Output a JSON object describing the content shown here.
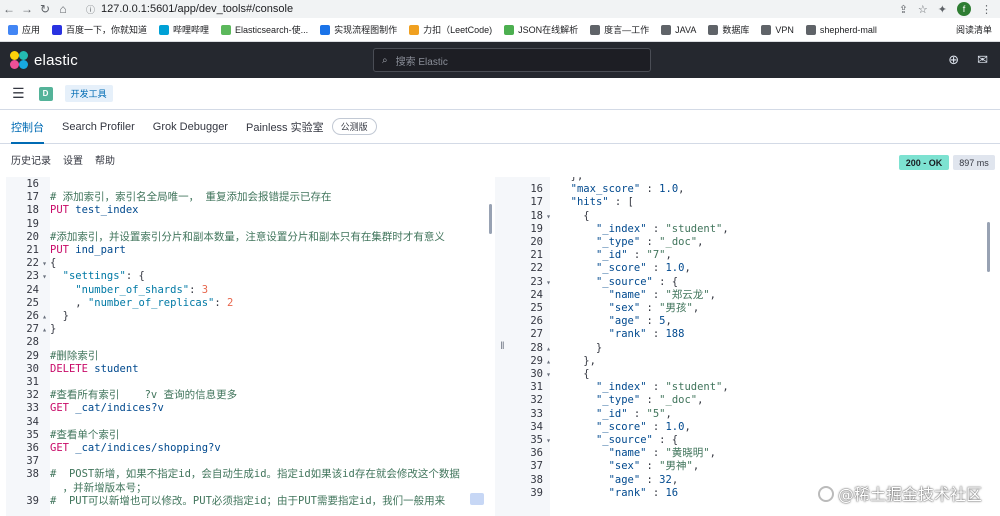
{
  "browser": {
    "url": "127.0.0.1:5601/app/dev_tools#/console",
    "profile_initial": "f"
  },
  "bookmarks": [
    {
      "label": "应用",
      "color": "#4285f4"
    },
    {
      "label": "百度一下，你就知道",
      "color": "#2932e1"
    },
    {
      "label": "哔哩哔哩",
      "color": "#00a1d6"
    },
    {
      "label": "Elasticsearch-使...",
      "color": "#5cb85c"
    },
    {
      "label": "实现流程图制作",
      "color": "#1a73e8"
    },
    {
      "label": "力扣（LeetCode)",
      "color": "#f0a020"
    },
    {
      "label": "JSON在线解析",
      "color": "#4caf50"
    },
    {
      "label": "度言—工作",
      "color": "#5f6368"
    },
    {
      "label": "JAVA",
      "color": "#5f6368"
    },
    {
      "label": "数据库",
      "color": "#5f6368"
    },
    {
      "label": "VPN",
      "color": "#5f6368"
    },
    {
      "label": "shepherd-mall",
      "color": "#5f6368"
    }
  ],
  "bookmarks_right": "阅读清单",
  "header": {
    "logo_text": "elastic",
    "search_placeholder": "搜索 Elastic"
  },
  "breadcrumb": {
    "space": "D",
    "current": "开发工具"
  },
  "tabs": [
    {
      "label": "控制台",
      "active": true
    },
    {
      "label": "Search Profiler",
      "active": false
    },
    {
      "label": "Grok Debugger",
      "active": false
    },
    {
      "label": "Painless 实验室",
      "active": false
    }
  ],
  "beta_label": "公测版",
  "toolbar": {
    "history": "历史记录",
    "settings": "设置",
    "help": "帮助",
    "status": "200 - OK",
    "time": "897 ms"
  },
  "request_lines": [
    {
      "n": "16",
      "f": "",
      "t": [
        [
          "",
          ""
        ]
      ]
    },
    {
      "n": "17",
      "f": "",
      "t": [
        [
          "comment",
          "# 添加索引，索引名全局唯一， 重复添加会报错提示已存在"
        ]
      ]
    },
    {
      "n": "18",
      "f": "",
      "t": [
        [
          "method",
          "PUT"
        ],
        [
          "path",
          " test_index"
        ]
      ]
    },
    {
      "n": "19",
      "f": "",
      "t": [
        [
          "",
          ""
        ]
      ]
    },
    {
      "n": "20",
      "f": "",
      "t": [
        [
          "comment",
          "#添加索引，并设置索引分片和副本数量，注意设置分片和副本只有在集群时才有意义"
        ]
      ]
    },
    {
      "n": "21",
      "f": "",
      "t": [
        [
          "method",
          "PUT"
        ],
        [
          "path",
          " ind_part"
        ]
      ]
    },
    {
      "n": "22",
      "f": "▾",
      "t": [
        [
          "punc",
          "{"
        ]
      ]
    },
    {
      "n": "23",
      "f": "▾",
      "t": [
        [
          "punc",
          "  "
        ],
        [
          "key",
          "\"settings\""
        ],
        [
          "punc",
          ": {"
        ]
      ]
    },
    {
      "n": "24",
      "f": "",
      "t": [
        [
          "punc",
          "    "
        ],
        [
          "key",
          "\"number_of_shards\""
        ],
        [
          "punc",
          ": "
        ],
        [
          "num",
          "3"
        ]
      ]
    },
    {
      "n": "25",
      "f": "",
      "t": [
        [
          "punc",
          "    , "
        ],
        [
          "key",
          "\"number_of_replicas\""
        ],
        [
          "punc",
          ": "
        ],
        [
          "num",
          "2"
        ]
      ]
    },
    {
      "n": "26",
      "f": "▴",
      "t": [
        [
          "punc",
          "  }"
        ]
      ]
    },
    {
      "n": "27",
      "f": "▴",
      "t": [
        [
          "punc",
          "}"
        ]
      ]
    },
    {
      "n": "28",
      "f": "",
      "t": [
        [
          "",
          ""
        ]
      ]
    },
    {
      "n": "29",
      "f": "",
      "t": [
        [
          "comment",
          "#删除索引"
        ]
      ]
    },
    {
      "n": "30",
      "f": "",
      "t": [
        [
          "method",
          "DELETE"
        ],
        [
          "path",
          " student"
        ]
      ]
    },
    {
      "n": "31",
      "f": "",
      "t": [
        [
          "",
          ""
        ]
      ]
    },
    {
      "n": "32",
      "f": "",
      "t": [
        [
          "comment",
          "#查看所有索引    ?v 查询的信息更多"
        ]
      ]
    },
    {
      "n": "33",
      "f": "",
      "t": [
        [
          "method",
          "GET"
        ],
        [
          "path",
          " _cat/indices?v"
        ]
      ]
    },
    {
      "n": "34",
      "f": "",
      "t": [
        [
          "",
          ""
        ]
      ]
    },
    {
      "n": "35",
      "f": "",
      "t": [
        [
          "comment",
          "#查看单个索引"
        ]
      ]
    },
    {
      "n": "36",
      "f": "",
      "t": [
        [
          "method",
          "GET"
        ],
        [
          "path",
          " _cat/indices/shopping?v"
        ]
      ]
    },
    {
      "n": "37",
      "f": "",
      "t": [
        [
          "",
          ""
        ]
      ]
    },
    {
      "n": "38",
      "f": "",
      "t": [
        [
          "comment",
          "#  POST新增，如果不指定id，会自动生成id。指定id如果该id存在就会修改这个数据"
        ]
      ]
    },
    {
      "n": "",
      "f": "",
      "t": [
        [
          "comment",
          "  ，并新增版本号；"
        ]
      ]
    },
    {
      "n": "39",
      "f": "",
      "t": [
        [
          "comment",
          "#  PUT可以新增也可以修改。PUT必须指定id；由于PUT需要指定id，我们一般用来"
        ]
      ]
    }
  ],
  "response_lines": [
    {
      "n": "",
      "f": "",
      "t": [
        [
          "punc",
          "  },"
        ]
      ]
    },
    {
      "n": "16",
      "f": "",
      "t": [
        [
          "punc",
          "  "
        ],
        [
          "rkey",
          "\"max_score\""
        ],
        [
          "punc",
          " : "
        ],
        [
          "rnum",
          "1.0"
        ],
        [
          "punc",
          ","
        ]
      ]
    },
    {
      "n": "17",
      "f": "",
      "t": [
        [
          "punc",
          "  "
        ],
        [
          "rkey",
          "\"hits\""
        ],
        [
          "punc",
          " : ["
        ]
      ]
    },
    {
      "n": "18",
      "f": "▾",
      "t": [
        [
          "punc",
          "    {"
        ]
      ]
    },
    {
      "n": "19",
      "f": "",
      "t": [
        [
          "punc",
          "      "
        ],
        [
          "rkey",
          "\"_index\""
        ],
        [
          "punc",
          " : "
        ],
        [
          "rstr",
          "\"student\""
        ],
        [
          "punc",
          ","
        ]
      ]
    },
    {
      "n": "20",
      "f": "",
      "t": [
        [
          "punc",
          "      "
        ],
        [
          "rkey",
          "\"_type\""
        ],
        [
          "punc",
          " : "
        ],
        [
          "rstr",
          "\"_doc\""
        ],
        [
          "punc",
          ","
        ]
      ]
    },
    {
      "n": "21",
      "f": "",
      "t": [
        [
          "punc",
          "      "
        ],
        [
          "rkey",
          "\"_id\""
        ],
        [
          "punc",
          " : "
        ],
        [
          "rstr",
          "\"7\""
        ],
        [
          "punc",
          ","
        ]
      ]
    },
    {
      "n": "22",
      "f": "",
      "t": [
        [
          "punc",
          "      "
        ],
        [
          "rkey",
          "\"_score\""
        ],
        [
          "punc",
          " : "
        ],
        [
          "rnum",
          "1.0"
        ],
        [
          "punc",
          ","
        ]
      ]
    },
    {
      "n": "23",
      "f": "▾",
      "t": [
        [
          "punc",
          "      "
        ],
        [
          "rkey",
          "\"_source\""
        ],
        [
          "punc",
          " : {"
        ]
      ]
    },
    {
      "n": "24",
      "f": "",
      "t": [
        [
          "punc",
          "        "
        ],
        [
          "rkey",
          "\"name\""
        ],
        [
          "punc",
          " : "
        ],
        [
          "rstr",
          "\"郑云龙\""
        ],
        [
          "punc",
          ","
        ]
      ]
    },
    {
      "n": "25",
      "f": "",
      "t": [
        [
          "punc",
          "        "
        ],
        [
          "rkey",
          "\"sex\""
        ],
        [
          "punc",
          " : "
        ],
        [
          "rstr",
          "\"男孩\""
        ],
        [
          "punc",
          ","
        ]
      ]
    },
    {
      "n": "26",
      "f": "",
      "t": [
        [
          "punc",
          "        "
        ],
        [
          "rkey",
          "\"age\""
        ],
        [
          "punc",
          " : "
        ],
        [
          "rnum",
          "5"
        ],
        [
          "punc",
          ","
        ]
      ]
    },
    {
      "n": "27",
      "f": "",
      "t": [
        [
          "punc",
          "        "
        ],
        [
          "rkey",
          "\"rank\""
        ],
        [
          "punc",
          " : "
        ],
        [
          "rnum",
          "188"
        ]
      ]
    },
    {
      "n": "28",
      "f": "▴",
      "t": [
        [
          "punc",
          "      }"
        ]
      ]
    },
    {
      "n": "29",
      "f": "▴",
      "t": [
        [
          "punc",
          "    },"
        ]
      ]
    },
    {
      "n": "30",
      "f": "▾",
      "t": [
        [
          "punc",
          "    {"
        ]
      ]
    },
    {
      "n": "31",
      "f": "",
      "t": [
        [
          "punc",
          "      "
        ],
        [
          "rkey",
          "\"_index\""
        ],
        [
          "punc",
          " : "
        ],
        [
          "rstr",
          "\"student\""
        ],
        [
          "punc",
          ","
        ]
      ]
    },
    {
      "n": "32",
      "f": "",
      "t": [
        [
          "punc",
          "      "
        ],
        [
          "rkey",
          "\"_type\""
        ],
        [
          "punc",
          " : "
        ],
        [
          "rstr",
          "\"_doc\""
        ],
        [
          "punc",
          ","
        ]
      ]
    },
    {
      "n": "33",
      "f": "",
      "t": [
        [
          "punc",
          "      "
        ],
        [
          "rkey",
          "\"_id\""
        ],
        [
          "punc",
          " : "
        ],
        [
          "rstr",
          "\"5\""
        ],
        [
          "punc",
          ","
        ]
      ]
    },
    {
      "n": "34",
      "f": "",
      "t": [
        [
          "punc",
          "      "
        ],
        [
          "rkey",
          "\"_score\""
        ],
        [
          "punc",
          " : "
        ],
        [
          "rnum",
          "1.0"
        ],
        [
          "punc",
          ","
        ]
      ]
    },
    {
      "n": "35",
      "f": "▾",
      "t": [
        [
          "punc",
          "      "
        ],
        [
          "rkey",
          "\"_source\""
        ],
        [
          "punc",
          " : {"
        ]
      ]
    },
    {
      "n": "36",
      "f": "",
      "t": [
        [
          "punc",
          "        "
        ],
        [
          "rkey",
          "\"name\""
        ],
        [
          "punc",
          " : "
        ],
        [
          "rstr",
          "\"黄晓明\""
        ],
        [
          "punc",
          ","
        ]
      ]
    },
    {
      "n": "37",
      "f": "",
      "t": [
        [
          "punc",
          "        "
        ],
        [
          "rkey",
          "\"sex\""
        ],
        [
          "punc",
          " : "
        ],
        [
          "rstr",
          "\"男神\""
        ],
        [
          "punc",
          ","
        ]
      ]
    },
    {
      "n": "38",
      "f": "",
      "t": [
        [
          "punc",
          "        "
        ],
        [
          "rkey",
          "\"age\""
        ],
        [
          "punc",
          " : "
        ],
        [
          "rnum",
          "32"
        ],
        [
          "punc",
          ","
        ]
      ]
    },
    {
      "n": "39",
      "f": "",
      "t": [
        [
          "punc",
          "        "
        ],
        [
          "rkey",
          "\"rank\""
        ],
        [
          "punc",
          " : "
        ],
        [
          "rnum",
          "16"
        ]
      ]
    }
  ],
  "watermark": "@稀土掘金技术社区",
  "colors": {
    "header_bg": "#25282f",
    "accent": "#006bb4",
    "status_ok": "#7de2d1"
  }
}
